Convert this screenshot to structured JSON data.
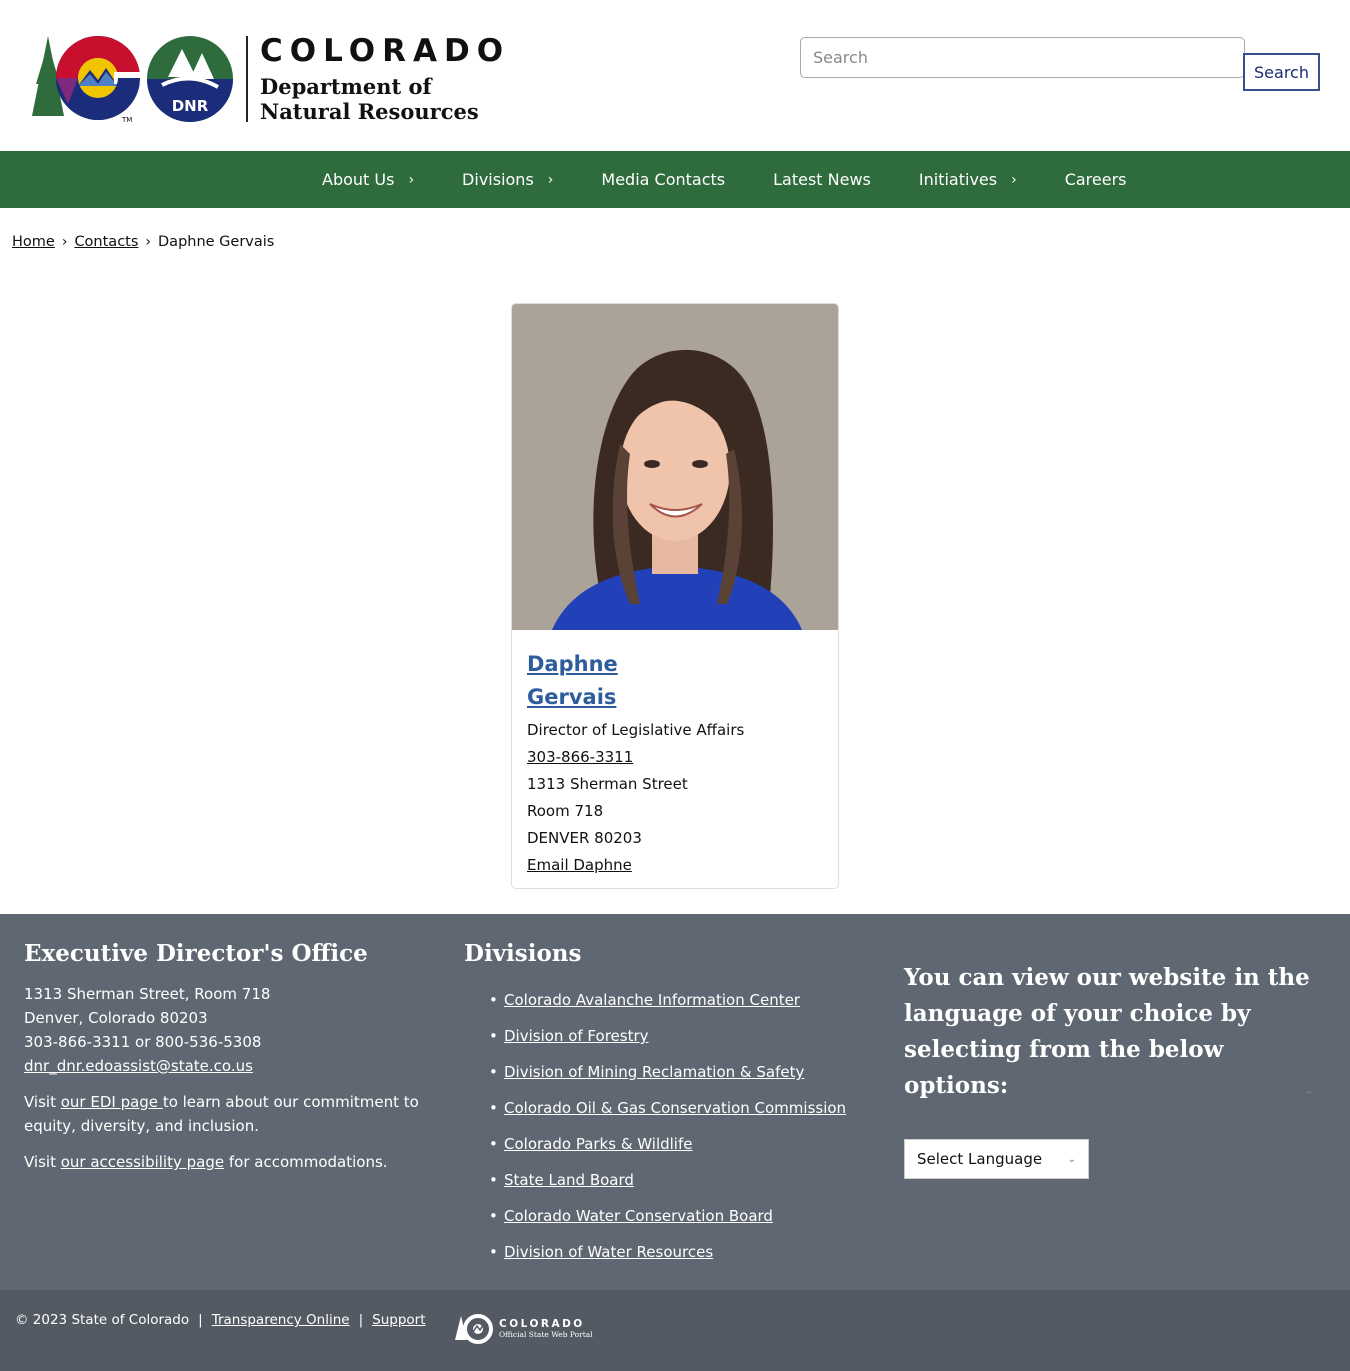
{
  "header": {
    "logo_state": "COLORADO",
    "logo_dept_line1": "Department of",
    "logo_dept_line2": "Natural Resources",
    "dnr_badge": "DNR",
    "search_placeholder": "Search",
    "search_button": "Search"
  },
  "nav": {
    "items": [
      {
        "label": "About Us",
        "has_submenu": true
      },
      {
        "label": "Divisions",
        "has_submenu": true
      },
      {
        "label": "Media Contacts",
        "has_submenu": false
      },
      {
        "label": "Latest News",
        "has_submenu": false
      },
      {
        "label": "Initiatives",
        "has_submenu": true
      },
      {
        "label": "Careers",
        "has_submenu": false
      }
    ],
    "chevron": "›",
    "color": "#2e6b3d"
  },
  "breadcrumb": {
    "home": "Home",
    "contacts": "Contacts",
    "current": "Daphne Gervais",
    "separator": "›"
  },
  "contact": {
    "name_line1": "Daphne",
    "name_line2": "Gervais",
    "title": "Director of Legislative Affairs",
    "phone": "303-866-3311",
    "street": "1313 Sherman Street",
    "room": "Room 718",
    "city": "DENVER 80203",
    "email_label": "Email Daphne",
    "name_color": "#2d5d9c"
  },
  "footer": {
    "office": {
      "heading": "Executive Director's Office",
      "address1": "1313 Sherman Street, Room 718",
      "address2": "Denver, Colorado 80203",
      "phones": "303-866-3311 or 800-536-5308",
      "email": "dnr_dnr.edoassist@state.co.us",
      "edi_prefix": "Visit ",
      "edi_link": "our EDI page ",
      "edi_suffix": "to learn about our commitment to equity, diversity, and inclusion.",
      "access_prefix": "Visit ",
      "access_link": "our accessibility page",
      "access_suffix": " for accommodations."
    },
    "divisions": {
      "heading": "Divisions",
      "items": [
        "Colorado Avalanche Information Center",
        "Division of Forestry",
        "Division of Mining Reclamation & Safety",
        "Colorado Oil & Gas Conservation Commission",
        "Colorado Parks & Wildlife",
        "State Land Board",
        "Colorado Water Conservation Board",
        "Division of Water Resources"
      ]
    },
    "language": {
      "heading": "You can view our website in the language of your choice by selecting from the below options:",
      "select_value": "Select Language"
    },
    "bg_color": "#5f6872"
  },
  "bottom": {
    "copyright": "© 2023 State of Colorado",
    "transparency": "Transparency Online",
    "support": "Support",
    "pipe": "|",
    "state_logo_name": "COLORADO",
    "state_logo_sub": "Official State Web Portal"
  }
}
